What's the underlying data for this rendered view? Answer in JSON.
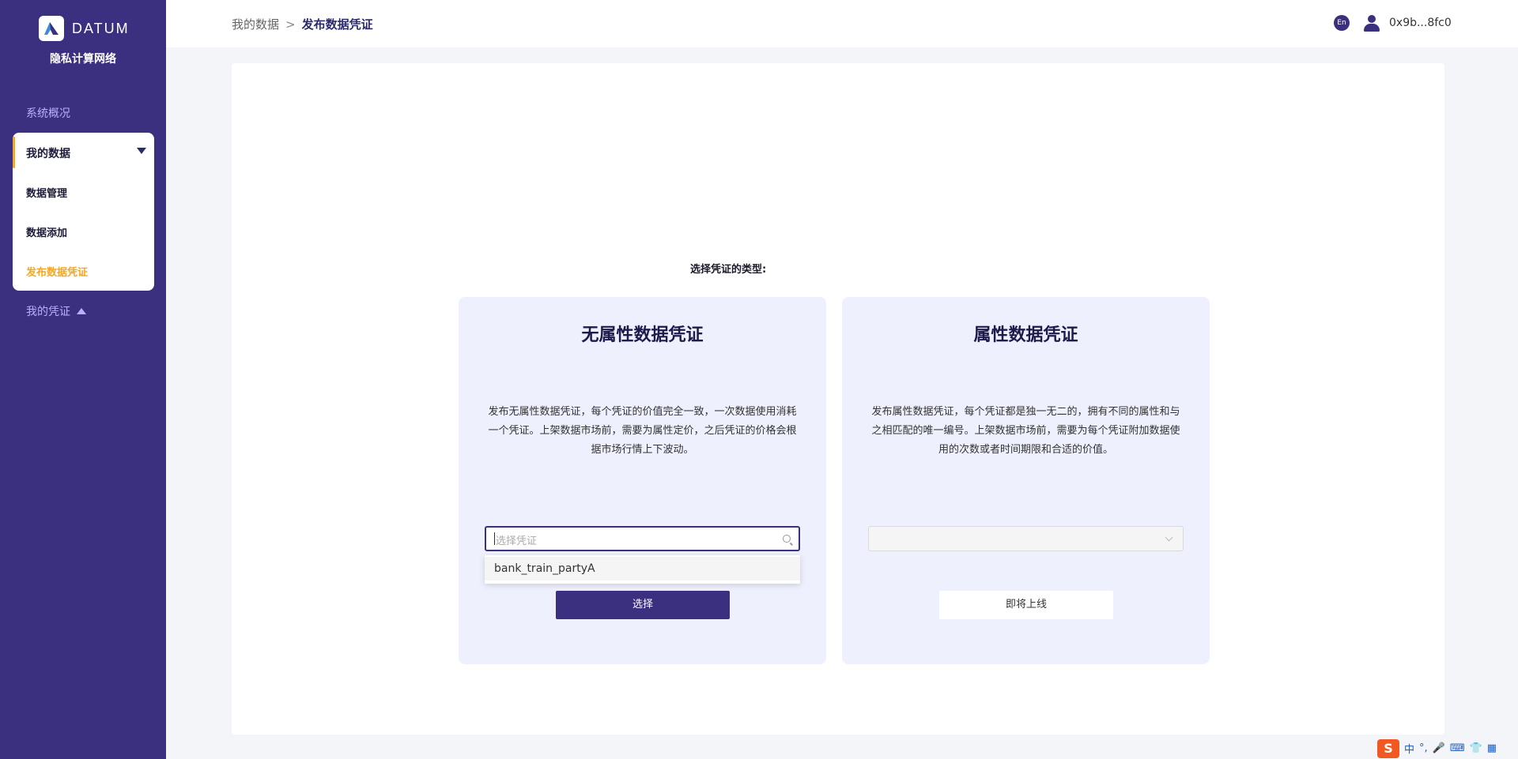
{
  "brand": {
    "logo_text": "DATUM",
    "network_name": "隐私计算网络"
  },
  "sidebar": {
    "overview": "系统概况",
    "my_data": "我的数据",
    "children": [
      "数据管理",
      "数据添加",
      "发布数据凭证"
    ],
    "my_credentials": "我的凭证"
  },
  "header": {
    "breadcrumb_parent": "我的数据",
    "breadcrumb_sep": ">",
    "breadcrumb_current": "发布数据凭证",
    "lang": "En",
    "address": "0x9b...8fc0"
  },
  "main": {
    "prompt": "选择凭证的类型:",
    "no_attr": {
      "title": "无属性数据凭证",
      "desc": "发布无属性数据凭证，每个凭证的价值完全一致，一次数据使用消耗一个凭证。上架数据市场前，需要为属性定价，之后凭证的价格会根据市场行情上下波动。",
      "placeholder": "选择凭证",
      "option": "bank_train_partyA",
      "button": "选择"
    },
    "attr": {
      "title": "属性数据凭证",
      "desc": "发布属性数据凭证，每个凭证都是独一无二的，拥有不同的属性和与之相匹配的唯一编号。上架数据市场前，需要为每个凭证附加数据使用的次数或者时间期限和合适的价值。",
      "button": "即将上线"
    }
  },
  "ime": {
    "logo": "S",
    "lang": "中",
    "punct": "°,"
  }
}
